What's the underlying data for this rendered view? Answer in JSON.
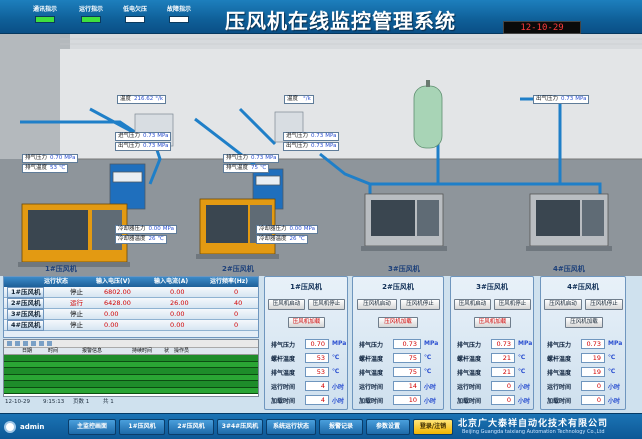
{
  "header": {
    "indicators": [
      {
        "label": "通讯指示",
        "color": "#3ee03e"
      },
      {
        "label": "运行指示",
        "color": "#3ee03e"
      },
      {
        "label": "低电欠压",
        "color": "#ffffff"
      },
      {
        "label": "故障指示",
        "color": "#ffffff"
      }
    ],
    "title": "压风机在线监控管理系统",
    "clock": "12-10-29 9:15:13"
  },
  "scene": {
    "top_tags": [
      {
        "label": "温度",
        "value": "216.62",
        "unit": "°/k"
      },
      {
        "label": "温度",
        "value": "",
        "unit": "°/k"
      },
      {
        "label": "出气压力",
        "value": "0.73",
        "unit": "MPa"
      }
    ],
    "tags": [
      {
        "label": "排气压力",
        "value": "0.70",
        "unit": "MPa"
      },
      {
        "label": "排气温度",
        "value": "53",
        "unit": "℃"
      },
      {
        "label": "进气压力",
        "value": "0.73",
        "unit": "MPa"
      },
      {
        "label": "出气压力",
        "value": "0.73",
        "unit": "MPa"
      },
      {
        "label": "冷却器压力",
        "value": "0.00",
        "unit": "MPa"
      },
      {
        "label": "冷却器温度",
        "value": "26",
        "unit": "℃"
      },
      {
        "label": "排气压力",
        "value": "0.73",
        "unit": "MPa"
      },
      {
        "label": "排气温度",
        "value": "75",
        "unit": "℃"
      },
      {
        "label": "进气压力",
        "value": "0.73",
        "unit": "MPa"
      },
      {
        "label": "出气压力",
        "value": "0.73",
        "unit": "MPa"
      },
      {
        "label": "冷却器压力",
        "value": "0.00",
        "unit": "MPa"
      },
      {
        "label": "冷却器温度",
        "value": "26",
        "unit": "℃"
      }
    ],
    "unit_labels": [
      "1#压风机",
      "2#压风机",
      "3#压风机",
      "4#压风机"
    ]
  },
  "status_table": {
    "headers": [
      "运行状态",
      "输入电压(V)",
      "输入电流(A)",
      "运行频率(Hz)"
    ],
    "rows": [
      {
        "name": "1#压风机",
        "state": "停止",
        "voltage": "6802.00",
        "current": "0.00",
        "freq": "0"
      },
      {
        "name": "2#压风机",
        "state": "运行",
        "voltage": "6428.00",
        "current": "26.00",
        "freq": "40"
      },
      {
        "name": "3#压风机",
        "state": "停止",
        "voltage": "0.00",
        "current": "0.00",
        "freq": "0"
      },
      {
        "name": "4#压风机",
        "state": "停止",
        "voltage": "0.00",
        "current": "0.00",
        "freq": "0"
      }
    ]
  },
  "event_grid": {
    "headers": [
      "日期",
      "时间",
      "报警信息",
      "持续时间",
      "状",
      "操作员"
    ],
    "footer": {
      "date": "12-10-29",
      "time": "9:15:13",
      "page": "页数 1",
      "total": "共 1"
    }
  },
  "panels": [
    {
      "title": "1#压风机",
      "buttons": [
        "压风机启动",
        "压风机停止",
        "压风机加载"
      ],
      "rows": [
        {
          "label": "排气压力",
          "value": "0.70",
          "unit": "MPa"
        },
        {
          "label": "螺杆温度",
          "value": "53",
          "unit": "℃"
        },
        {
          "label": "排气温度",
          "value": "53",
          "unit": "℃"
        },
        {
          "label": "运行时间",
          "value": "4",
          "unit": "小时"
        },
        {
          "label": "加载时间",
          "value": "4",
          "unit": "小时"
        }
      ]
    },
    {
      "title": "2#压风机",
      "buttons": [
        "压风机启动",
        "压风机停止",
        "压风机加载"
      ],
      "rows": [
        {
          "label": "排气压力",
          "value": "0.73",
          "unit": "MPa"
        },
        {
          "label": "螺杆温度",
          "value": "75",
          "unit": "℃"
        },
        {
          "label": "排气温度",
          "value": "75",
          "unit": "℃"
        },
        {
          "label": "运行时间",
          "value": "14",
          "unit": "小时"
        },
        {
          "label": "加载时间",
          "value": "10",
          "unit": "小时"
        }
      ]
    },
    {
      "title": "3#压风机",
      "buttons": [
        "压风机启动",
        "压风机停止",
        "压风机加载"
      ],
      "rows": [
        {
          "label": "排气压力",
          "value": "0.73",
          "unit": "MPa"
        },
        {
          "label": "螺杆温度",
          "value": "21",
          "unit": "℃"
        },
        {
          "label": "排气温度",
          "value": "21",
          "unit": "℃"
        },
        {
          "label": "运行时间",
          "value": "0",
          "unit": "小时"
        },
        {
          "label": "加载时间",
          "value": "0",
          "unit": "小时"
        }
      ]
    },
    {
      "title": "4#压风机",
      "buttons": [
        "压风机启动",
        "压风机停止",
        "压风机加载"
      ],
      "rows": [
        {
          "label": "排气压力",
          "value": "0.73",
          "unit": "MPa"
        },
        {
          "label": "螺杆温度",
          "value": "19",
          "unit": "℃"
        },
        {
          "label": "排气温度",
          "value": "19",
          "unit": "℃"
        },
        {
          "label": "运行时间",
          "value": "0",
          "unit": "小时"
        },
        {
          "label": "加载时间",
          "value": "0",
          "unit": "小时"
        }
      ]
    }
  ],
  "footer": {
    "user": "admin",
    "nav": [
      "主监控画面",
      "1#压风机",
      "2#压风机",
      "3#4#压风机",
      "系统运行状态",
      "报警记录",
      "参数设置",
      "登录/注销"
    ],
    "company": "北京广大泰祥自动化技术有限公司",
    "company_en": "Beijing Guangda taixiang Automation Technology Co.,Ltd"
  }
}
